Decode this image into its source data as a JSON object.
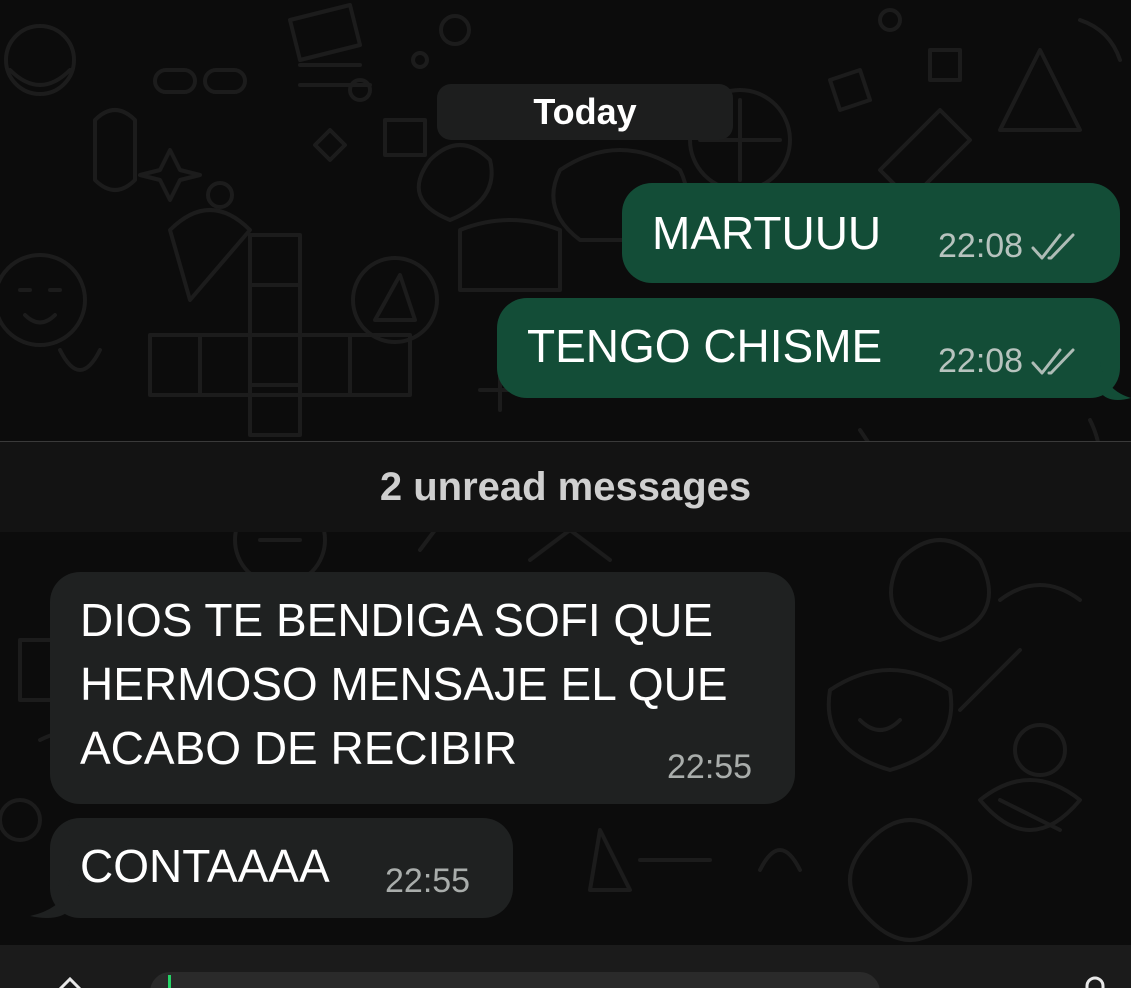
{
  "date_chip": "Today",
  "outgoing": [
    {
      "text": "MARTUUU",
      "time": "22:08",
      "status_icon": "double-check-icon"
    },
    {
      "text": "TENGO CHISME",
      "time": "22:08",
      "status_icon": "double-check-icon"
    }
  ],
  "unread_label": "2 unread messages",
  "incoming": [
    {
      "text": "DIOS TE BENDIGA SOFI QUE\nHERMOSO MENSAJE EL QUE\nACABO DE RECIBIR",
      "time": "22:55"
    },
    {
      "text": "CONTAAAA",
      "time": "22:55"
    }
  ],
  "colors": {
    "outgoing_bubble": "#134d37",
    "incoming_bubble": "#1f2121",
    "background": "#0c0c0c",
    "caret": "#25d366"
  },
  "icons": [
    "plus-icon",
    "microphone-icon",
    "double-check-icon"
  ]
}
